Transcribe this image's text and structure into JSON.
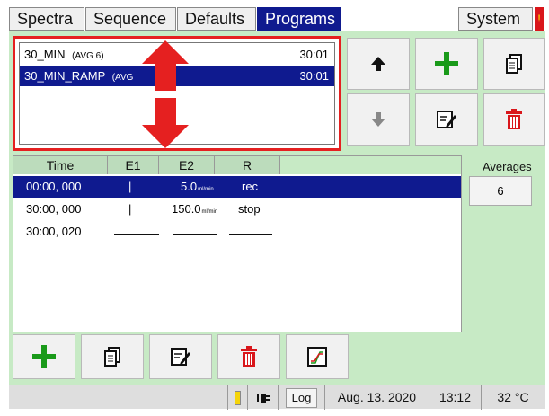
{
  "tabs": {
    "spectra": "Spectra",
    "sequence": "Sequence",
    "defaults": "Defaults",
    "programs": "Programs",
    "system": "System"
  },
  "programs": [
    {
      "name": "30_MIN",
      "avg": "(AVG 6)",
      "duration": "30:01",
      "selected": false
    },
    {
      "name": "30_MIN_RAMP",
      "avg": "(AVG",
      "duration": "30:01",
      "selected": true
    }
  ],
  "table": {
    "headers": [
      "Time",
      "E1",
      "E2",
      "R"
    ],
    "unit": "ml/min",
    "rows": [
      {
        "time": "00:00, 000",
        "e1": "|",
        "e2": "5.0",
        "r": "rec",
        "selected": true
      },
      {
        "time": "30:00, 000",
        "e1": "|",
        "e2": "150.0",
        "r": "stop",
        "selected": false
      },
      {
        "time": "30:00, 020",
        "e1": "",
        "e2": "",
        "r": "",
        "selected": false
      }
    ]
  },
  "averages": {
    "label": "Averages",
    "value": "6"
  },
  "status": {
    "log": "Log",
    "date": "Aug. 13. 2020",
    "time": "13:12",
    "temperature": "32 °C"
  },
  "icons": {
    "up": "arrow-up-icon",
    "down": "arrow-down-icon",
    "add": "plus-icon",
    "copy": "copy-icon",
    "edit": "edit-icon",
    "delete": "trash-icon",
    "chart": "ramp-chart-icon"
  },
  "colors": {
    "accent": "#0f1a8f",
    "green": "#1a9a1a",
    "red": "#d9161b",
    "panel": "#c7eac5",
    "highlight": "#e52020"
  }
}
